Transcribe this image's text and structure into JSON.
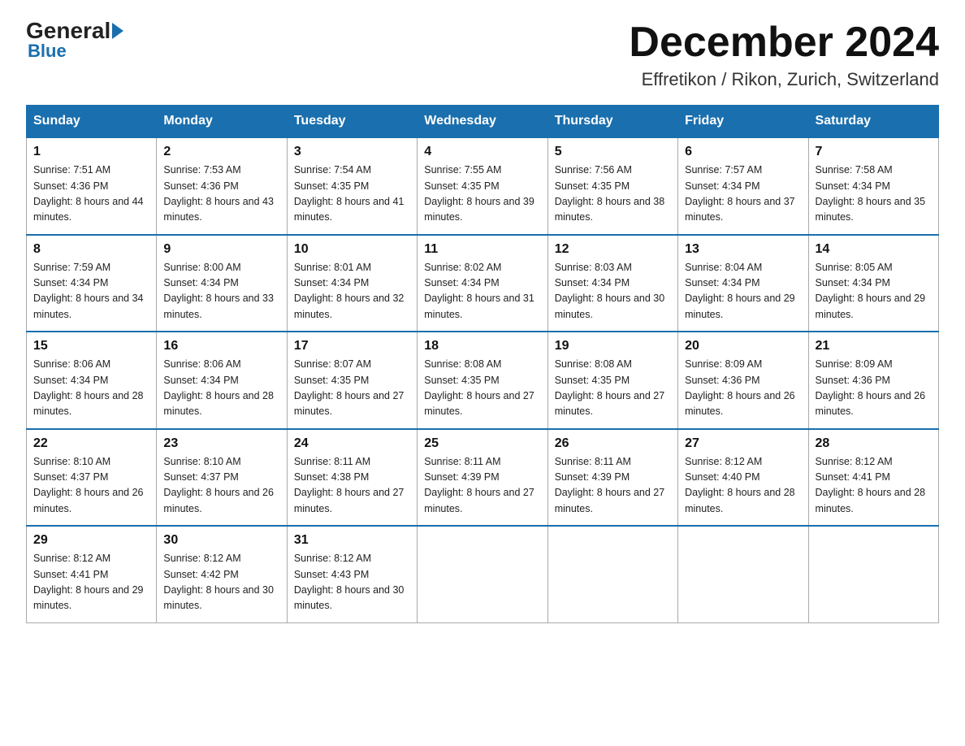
{
  "logo": {
    "general": "General",
    "blue": "Blue",
    "sub": "Blue"
  },
  "title": {
    "month": "December 2024",
    "location": "Effretikon / Rikon, Zurich, Switzerland"
  },
  "headers": [
    "Sunday",
    "Monday",
    "Tuesday",
    "Wednesday",
    "Thursday",
    "Friday",
    "Saturday"
  ],
  "weeks": [
    [
      {
        "num": "1",
        "sunrise": "7:51 AM",
        "sunset": "4:36 PM",
        "daylight": "8 hours and 44 minutes."
      },
      {
        "num": "2",
        "sunrise": "7:53 AM",
        "sunset": "4:36 PM",
        "daylight": "8 hours and 43 minutes."
      },
      {
        "num": "3",
        "sunrise": "7:54 AM",
        "sunset": "4:35 PM",
        "daylight": "8 hours and 41 minutes."
      },
      {
        "num": "4",
        "sunrise": "7:55 AM",
        "sunset": "4:35 PM",
        "daylight": "8 hours and 39 minutes."
      },
      {
        "num": "5",
        "sunrise": "7:56 AM",
        "sunset": "4:35 PM",
        "daylight": "8 hours and 38 minutes."
      },
      {
        "num": "6",
        "sunrise": "7:57 AM",
        "sunset": "4:34 PM",
        "daylight": "8 hours and 37 minutes."
      },
      {
        "num": "7",
        "sunrise": "7:58 AM",
        "sunset": "4:34 PM",
        "daylight": "8 hours and 35 minutes."
      }
    ],
    [
      {
        "num": "8",
        "sunrise": "7:59 AM",
        "sunset": "4:34 PM",
        "daylight": "8 hours and 34 minutes."
      },
      {
        "num": "9",
        "sunrise": "8:00 AM",
        "sunset": "4:34 PM",
        "daylight": "8 hours and 33 minutes."
      },
      {
        "num": "10",
        "sunrise": "8:01 AM",
        "sunset": "4:34 PM",
        "daylight": "8 hours and 32 minutes."
      },
      {
        "num": "11",
        "sunrise": "8:02 AM",
        "sunset": "4:34 PM",
        "daylight": "8 hours and 31 minutes."
      },
      {
        "num": "12",
        "sunrise": "8:03 AM",
        "sunset": "4:34 PM",
        "daylight": "8 hours and 30 minutes."
      },
      {
        "num": "13",
        "sunrise": "8:04 AM",
        "sunset": "4:34 PM",
        "daylight": "8 hours and 29 minutes."
      },
      {
        "num": "14",
        "sunrise": "8:05 AM",
        "sunset": "4:34 PM",
        "daylight": "8 hours and 29 minutes."
      }
    ],
    [
      {
        "num": "15",
        "sunrise": "8:06 AM",
        "sunset": "4:34 PM",
        "daylight": "8 hours and 28 minutes."
      },
      {
        "num": "16",
        "sunrise": "8:06 AM",
        "sunset": "4:34 PM",
        "daylight": "8 hours and 28 minutes."
      },
      {
        "num": "17",
        "sunrise": "8:07 AM",
        "sunset": "4:35 PM",
        "daylight": "8 hours and 27 minutes."
      },
      {
        "num": "18",
        "sunrise": "8:08 AM",
        "sunset": "4:35 PM",
        "daylight": "8 hours and 27 minutes."
      },
      {
        "num": "19",
        "sunrise": "8:08 AM",
        "sunset": "4:35 PM",
        "daylight": "8 hours and 27 minutes."
      },
      {
        "num": "20",
        "sunrise": "8:09 AM",
        "sunset": "4:36 PM",
        "daylight": "8 hours and 26 minutes."
      },
      {
        "num": "21",
        "sunrise": "8:09 AM",
        "sunset": "4:36 PM",
        "daylight": "8 hours and 26 minutes."
      }
    ],
    [
      {
        "num": "22",
        "sunrise": "8:10 AM",
        "sunset": "4:37 PM",
        "daylight": "8 hours and 26 minutes."
      },
      {
        "num": "23",
        "sunrise": "8:10 AM",
        "sunset": "4:37 PM",
        "daylight": "8 hours and 26 minutes."
      },
      {
        "num": "24",
        "sunrise": "8:11 AM",
        "sunset": "4:38 PM",
        "daylight": "8 hours and 27 minutes."
      },
      {
        "num": "25",
        "sunrise": "8:11 AM",
        "sunset": "4:39 PM",
        "daylight": "8 hours and 27 minutes."
      },
      {
        "num": "26",
        "sunrise": "8:11 AM",
        "sunset": "4:39 PM",
        "daylight": "8 hours and 27 minutes."
      },
      {
        "num": "27",
        "sunrise": "8:12 AM",
        "sunset": "4:40 PM",
        "daylight": "8 hours and 28 minutes."
      },
      {
        "num": "28",
        "sunrise": "8:12 AM",
        "sunset": "4:41 PM",
        "daylight": "8 hours and 28 minutes."
      }
    ],
    [
      {
        "num": "29",
        "sunrise": "8:12 AM",
        "sunset": "4:41 PM",
        "daylight": "8 hours and 29 minutes."
      },
      {
        "num": "30",
        "sunrise": "8:12 AM",
        "sunset": "4:42 PM",
        "daylight": "8 hours and 30 minutes."
      },
      {
        "num": "31",
        "sunrise": "8:12 AM",
        "sunset": "4:43 PM",
        "daylight": "8 hours and 30 minutes."
      },
      null,
      null,
      null,
      null
    ]
  ]
}
